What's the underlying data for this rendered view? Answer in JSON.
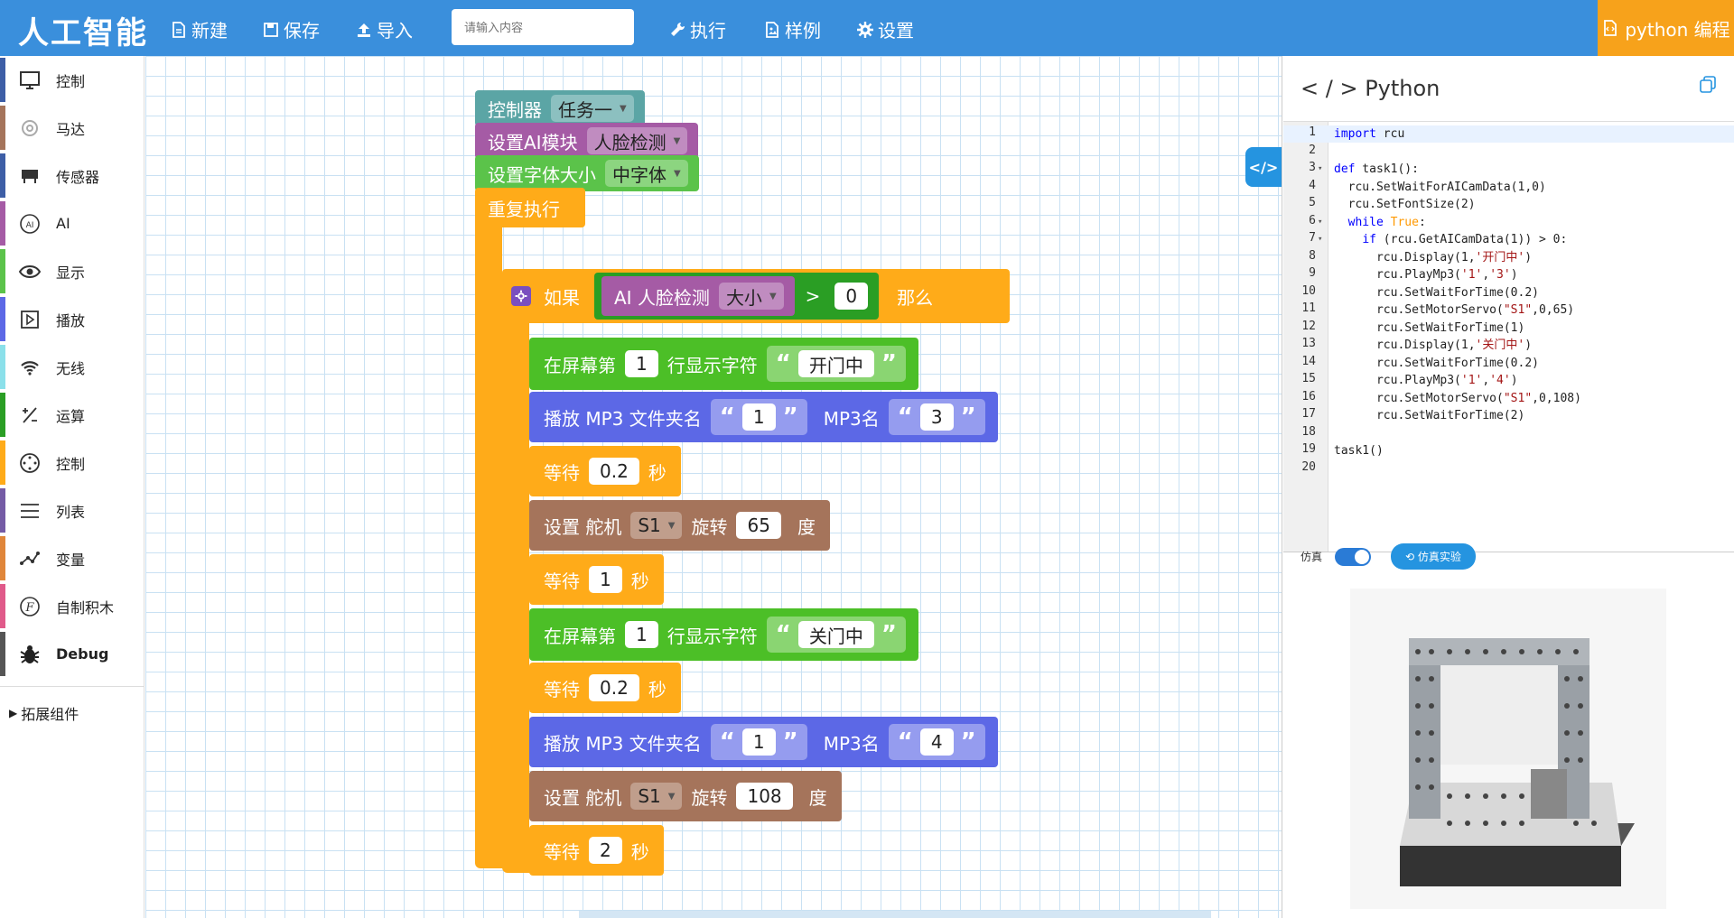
{
  "topbar": {
    "brand": "人工智能",
    "new": "新建",
    "save": "保存",
    "import": "导入",
    "search_placeholder": "请输入内容",
    "run": "执行",
    "examples": "样例",
    "settings": "设置",
    "python": "python 编程"
  },
  "sidebar": {
    "items": [
      {
        "label": "控制",
        "color": "#3d5ea6",
        "icon": "monitor-icon"
      },
      {
        "label": "马达",
        "color": "#a5745b",
        "icon": "motor-icon"
      },
      {
        "label": "传感器",
        "color": "#3d5ea6",
        "icon": "sensor-icon"
      },
      {
        "label": "AI",
        "color": "#a55ba5",
        "icon": "ai-icon"
      },
      {
        "label": "显示",
        "color": "#5bc34a",
        "icon": "eye-icon"
      },
      {
        "label": "播放",
        "color": "#5c68e6",
        "icon": "play-icon"
      },
      {
        "label": "无线",
        "color": "#8be0ea",
        "icon": "wifi-icon"
      },
      {
        "label": "运算",
        "color": "#2a9e24",
        "icon": "math-icon"
      },
      {
        "label": "控制",
        "color": "#ffab19",
        "icon": "control-icon"
      },
      {
        "label": "列表",
        "color": "#745ba5",
        "icon": "list-icon"
      },
      {
        "label": "变量",
        "color": "#e0863a",
        "icon": "variable-icon"
      },
      {
        "label": "自制积木",
        "color": "#e05a8a",
        "icon": "function-icon"
      },
      {
        "label": "Debug",
        "color": "#555555",
        "icon": "bug-icon"
      }
    ],
    "extensions": "拓展组件"
  },
  "blocks": {
    "controller": "控制器",
    "task": "任务一",
    "set_ai": "设置AI模块",
    "face_detect": "人脸检测",
    "set_font": "设置字体大小",
    "font_mid": "中字体",
    "repeat": "重复执行",
    "if": "如果",
    "ai_face": "AI 人脸检测",
    "size": "大小",
    "gt": ">",
    "zero": "0",
    "then": "那么",
    "screen_line": "在屏幕第",
    "line_text": "行显示字符",
    "one": "1",
    "open_door": "开门中",
    "close_door": "关门中",
    "mp3_folder": "播放 MP3 文件夹名",
    "mp3_name": "MP3名",
    "three": "3",
    "four": "4",
    "wait": "等待",
    "sec": "秒",
    "v02": "0.2",
    "v1": "1",
    "v2": "2",
    "servo_set": "设置 舵机",
    "s1": "S1",
    "rotate": "旋转",
    "deg": "度",
    "v65": "65",
    "v108": "108",
    "lq": "“",
    "rq": "”"
  },
  "python_panel": {
    "title": "< / > Python",
    "sim_label": "仿真",
    "sim_button": "仿真实验",
    "lines": [
      {
        "n": "1",
        "fold": "",
        "code": "import rcu"
      },
      {
        "n": "2",
        "fold": "",
        "code": ""
      },
      {
        "n": "3",
        "fold": "▾",
        "code": "def task1():"
      },
      {
        "n": "4",
        "fold": "",
        "code": "  rcu.SetWaitForAICamData(1,0)"
      },
      {
        "n": "5",
        "fold": "",
        "code": "  rcu.SetFontSize(2)"
      },
      {
        "n": "6",
        "fold": "▾",
        "code": "  while True:"
      },
      {
        "n": "7",
        "fold": "▾",
        "code": "    if (rcu.GetAICamData(1)) > 0:"
      },
      {
        "n": "8",
        "fold": "",
        "code": "      rcu.Display(1,'开门中')"
      },
      {
        "n": "9",
        "fold": "",
        "code": "      rcu.PlayMp3('1','3')"
      },
      {
        "n": "10",
        "fold": "",
        "code": "      rcu.SetWaitForTime(0.2)"
      },
      {
        "n": "11",
        "fold": "",
        "code": "      rcu.SetMotorServo(\"S1\",0,65)"
      },
      {
        "n": "12",
        "fold": "",
        "code": "      rcu.SetWaitForTime(1)"
      },
      {
        "n": "13",
        "fold": "",
        "code": "      rcu.Display(1,'关门中')"
      },
      {
        "n": "14",
        "fold": "",
        "code": "      rcu.SetWaitForTime(0.2)"
      },
      {
        "n": "15",
        "fold": "",
        "code": "      rcu.PlayMp3('1','4')"
      },
      {
        "n": "16",
        "fold": "",
        "code": "      rcu.SetMotorServo(\"S1\",0,108)"
      },
      {
        "n": "17",
        "fold": "",
        "code": "      rcu.SetWaitForTime(2)"
      },
      {
        "n": "18",
        "fold": "",
        "code": ""
      },
      {
        "n": "19",
        "fold": "",
        "code": "task1()"
      },
      {
        "n": "20",
        "fold": "",
        "code": ""
      }
    ]
  }
}
